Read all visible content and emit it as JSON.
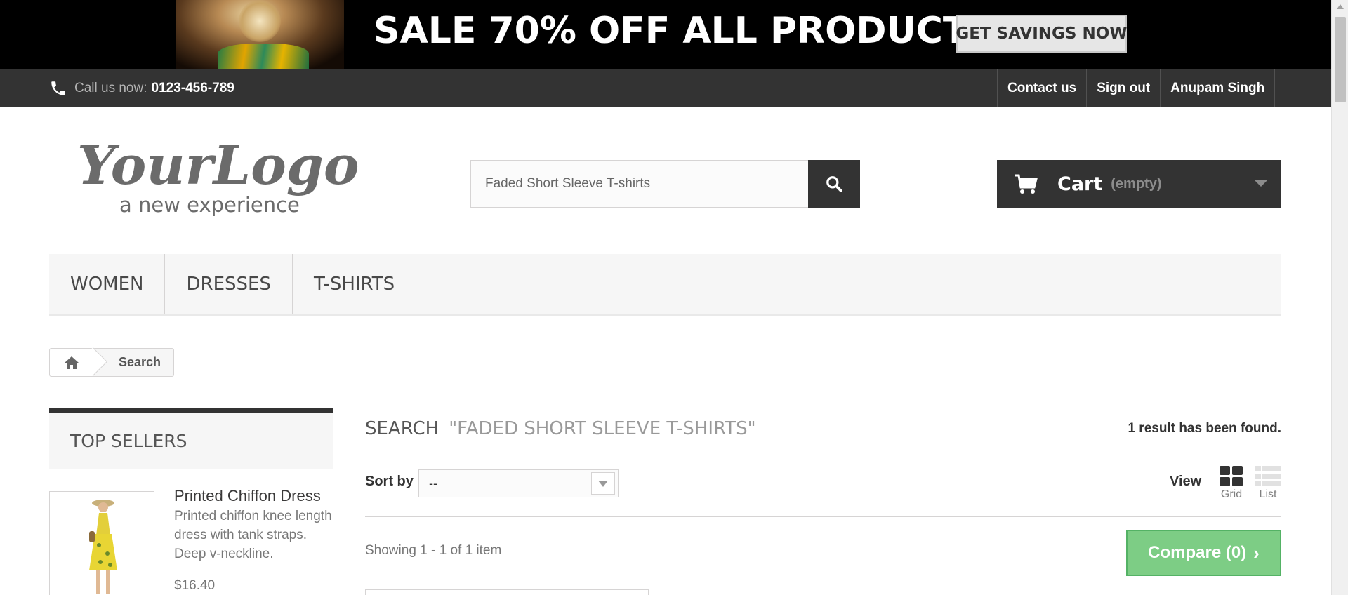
{
  "banner": {
    "title": "SALE 70% OFF ALL PRODUCTS",
    "button_label": "GET SAVINGS NOW"
  },
  "topbar": {
    "call_label": "Call us now:",
    "phone": "0123-456-789",
    "links": [
      "Contact us",
      "Sign out",
      "Anupam Singh"
    ]
  },
  "header": {
    "logo_main": "YourLogo",
    "logo_tagline": "a new experience",
    "search_value": "Faded Short Sleeve T-shirts",
    "cart_label": "Cart",
    "cart_status": "(empty)"
  },
  "menu": {
    "categories": [
      "WOMEN",
      "DRESSES",
      "T-SHIRTS"
    ]
  },
  "breadcrumb": {
    "current": "Search"
  },
  "sidebar": {
    "heading": "TOP SELLERS",
    "product": {
      "name": "Printed Chiffon Dress",
      "description": "Printed chiffon knee length dress with tank straps. Deep v-neckline.",
      "price": "$16.40"
    }
  },
  "main": {
    "search_heading": "SEARCH",
    "search_query": "\"FADED SHORT SLEEVE T-SHIRTS\"",
    "results_count": "1 result has been found.",
    "sort_label": "Sort by",
    "sort_value": "--",
    "view_label": "View",
    "view_grid": "Grid",
    "view_list": "List",
    "showing": "Showing 1 - 1 of 1 item",
    "compare_label": "Compare (0)"
  },
  "colors": {
    "dark": "#333333",
    "compare_green": "#7dcd85",
    "menu_bg": "#f6f6f6"
  }
}
